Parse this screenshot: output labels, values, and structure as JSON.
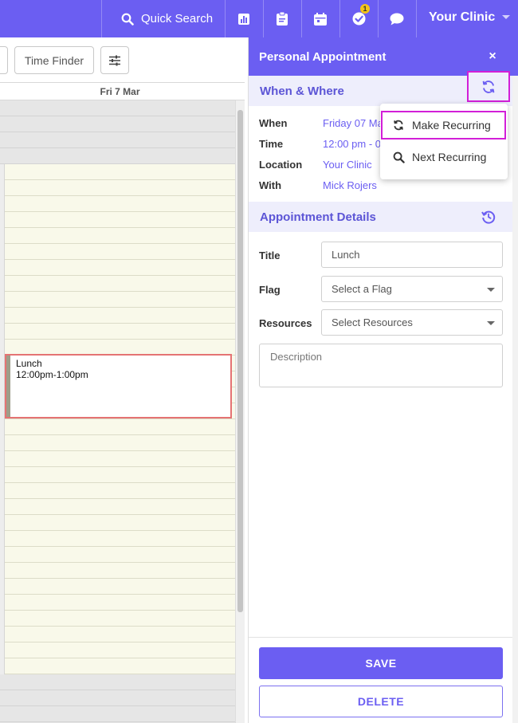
{
  "topbar": {
    "quick_search_label": "Quick Search",
    "notification_count": "1",
    "clinic_label": "Your Clinic"
  },
  "calendar_toolbar": {
    "time_finder_label": "Time Finder"
  },
  "calendar": {
    "day_header": "Fri 7 Mar",
    "event": {
      "title": "Lunch",
      "time": "12:00pm-1:00pm"
    }
  },
  "panel": {
    "title": "Personal Appointment",
    "close_label": "×",
    "when_where": {
      "title": "When & Where",
      "rows": [
        {
          "label": "When",
          "value": "Friday 07 Ma"
        },
        {
          "label": "Time",
          "value": "12:00 pm - 0"
        },
        {
          "label": "Location",
          "value": "Your Clinic"
        },
        {
          "label": "With",
          "value": "Mick Rojers"
        }
      ]
    },
    "details": {
      "title": "Appointment Details",
      "title_label": "Title",
      "title_value": "Lunch",
      "flag_label": "Flag",
      "flag_placeholder": "Select a Flag",
      "resources_label": "Resources",
      "resources_placeholder": "Select Resources",
      "description_placeholder": "Description"
    },
    "save_label": "SAVE",
    "delete_label": "DELETE"
  },
  "recurring_menu": {
    "items": [
      {
        "label": "Make Recurring",
        "icon": "sync-icon"
      },
      {
        "label": "Next Recurring",
        "icon": "search-icon"
      }
    ]
  },
  "colors": {
    "brand": "#6b5ef2",
    "highlight": "#d21fd8",
    "event_border": "#e57373"
  }
}
